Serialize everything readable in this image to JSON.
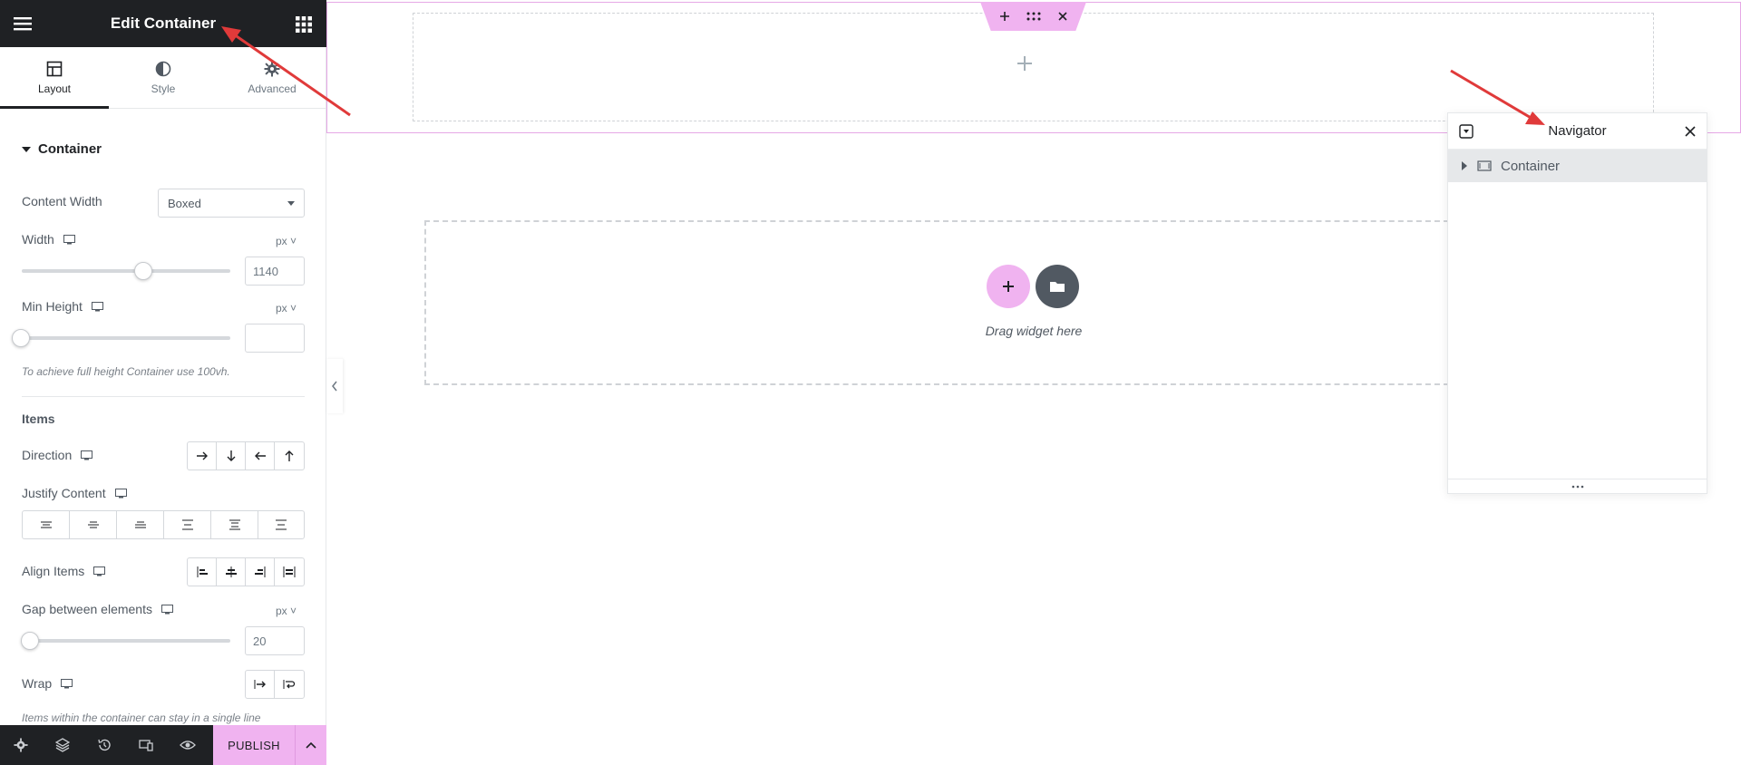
{
  "panel": {
    "title": "Edit Container",
    "tabs": [
      {
        "label": "Layout",
        "icon": "layout-icon",
        "active": true
      },
      {
        "label": "Style",
        "icon": "contrast-icon",
        "active": false
      },
      {
        "label": "Advanced",
        "icon": "gear-icon",
        "active": false
      }
    ],
    "section_title": "Container",
    "content_width": {
      "label": "Content Width",
      "value": "Boxed"
    },
    "width": {
      "label": "Width",
      "unit": "px",
      "value": "1140"
    },
    "min_height": {
      "label": "Min Height",
      "unit": "px",
      "value": "",
      "hint": "To achieve full height Container use 100vh."
    },
    "items_title": "Items",
    "direction": {
      "label": "Direction"
    },
    "justify_content": {
      "label": "Justify Content"
    },
    "align_items": {
      "label": "Align Items"
    },
    "gap": {
      "label": "Gap between elements",
      "unit": "px",
      "value": "20"
    },
    "wrap": {
      "label": "Wrap",
      "hint": "Items within the container can stay in a single line"
    }
  },
  "footer": {
    "publish_label": "PUBLISH"
  },
  "canvas": {
    "drop_hint": "Drag widget here"
  },
  "navigator": {
    "title": "Navigator",
    "items": [
      {
        "label": "Container"
      }
    ]
  },
  "colors": {
    "accent_pink": "#f0b3f0",
    "dark": "#1f2124",
    "annotation_red": "#e03a3a"
  }
}
